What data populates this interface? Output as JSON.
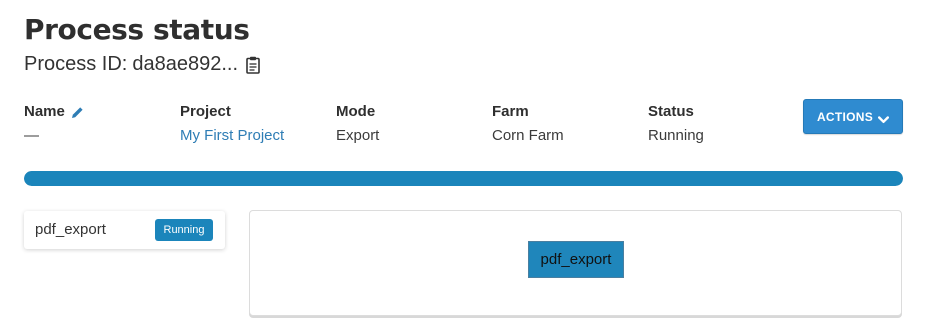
{
  "header": {
    "title": "Process status",
    "process_id_label": "Process ID:",
    "process_id_value": "da8ae892...",
    "copy_icon": "clipboard-icon"
  },
  "info": {
    "name": {
      "label": "Name",
      "value": "—",
      "edit_icon": "pencil-icon"
    },
    "project": {
      "label": "Project",
      "value": "My First Project"
    },
    "mode": {
      "label": "Mode",
      "value": "Export"
    },
    "farm": {
      "label": "Farm",
      "value": "Corn Farm"
    },
    "status": {
      "label": "Status",
      "value": "Running"
    }
  },
  "actions": {
    "label": "ACTIONS",
    "icon": "chevron-down-icon",
    "color": "#2f8bd0"
  },
  "progress": {
    "fraction": 1.0,
    "color": "#1b85bb"
  },
  "tasks": [
    {
      "name": "pdf_export",
      "status": "Running"
    }
  ],
  "graph": {
    "nodes": [
      {
        "label": "pdf_export"
      }
    ]
  },
  "colors": {
    "accent": "#1b85bb",
    "link": "#2e7db5"
  }
}
